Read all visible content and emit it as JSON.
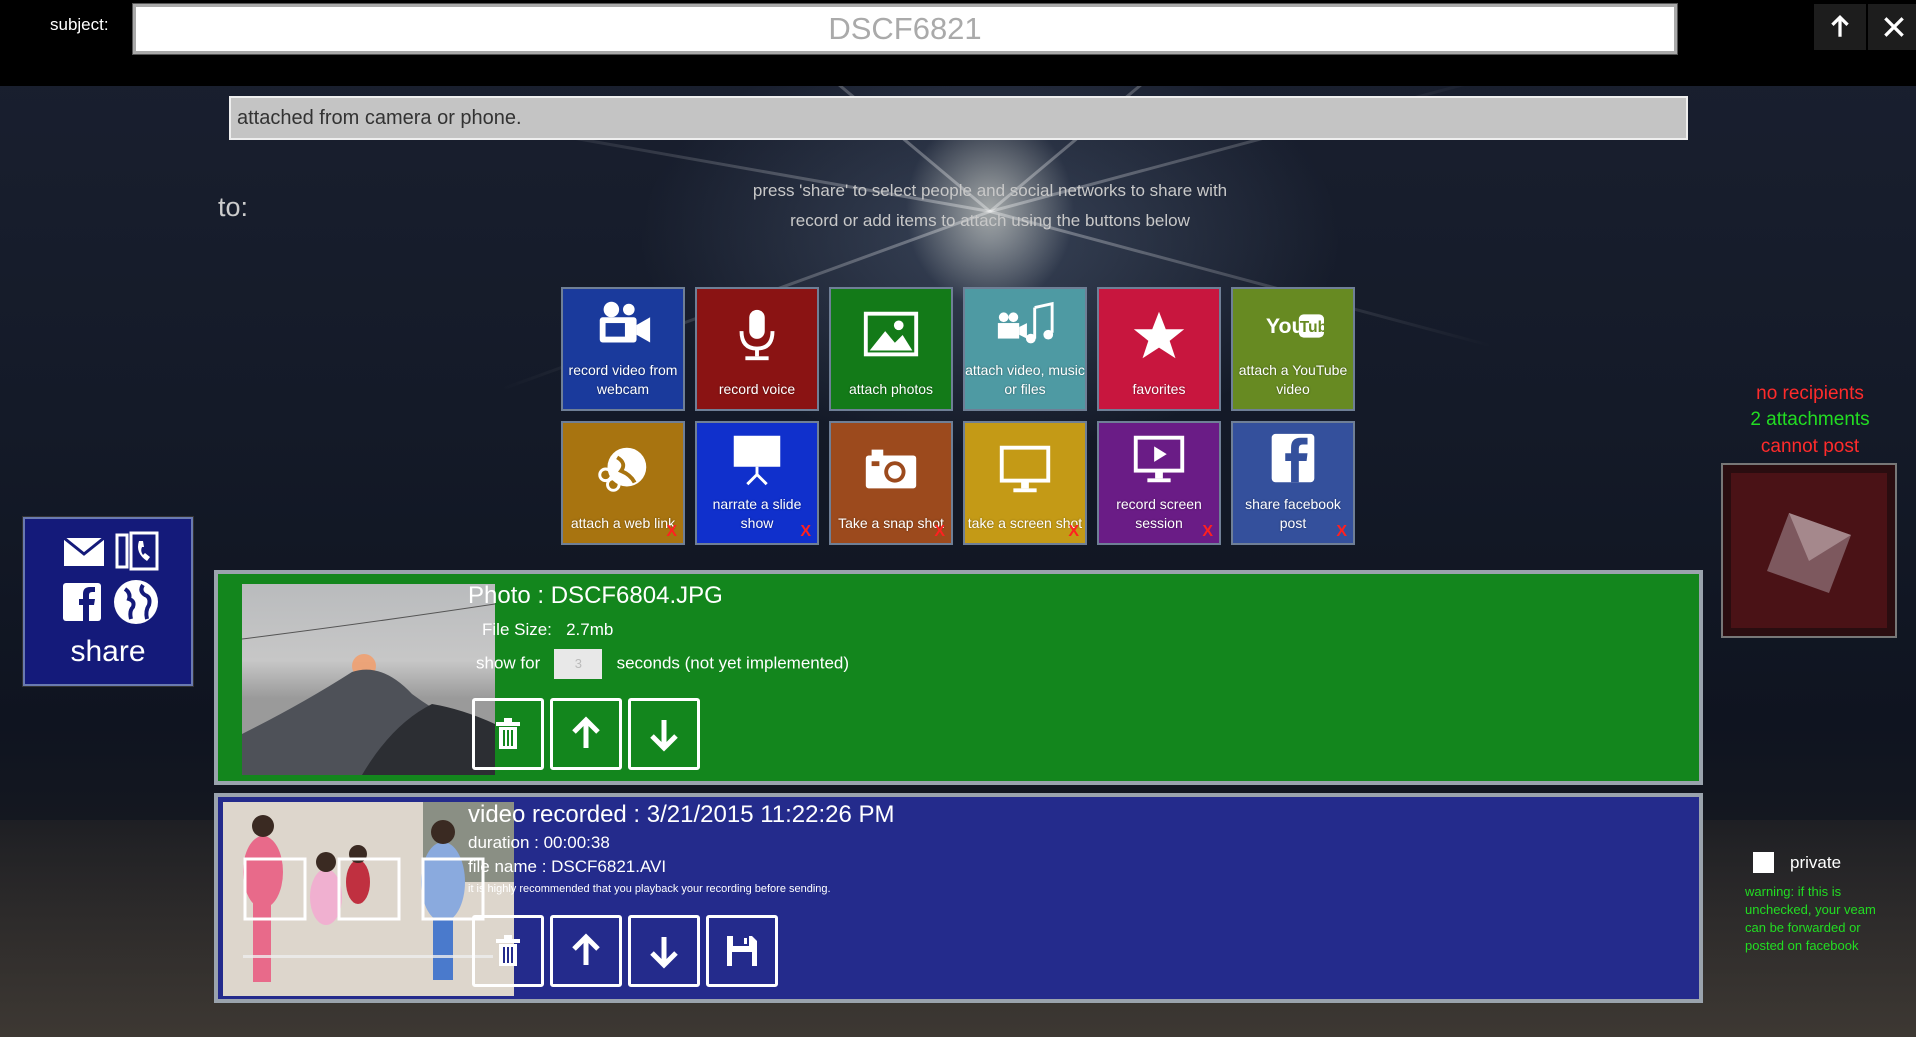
{
  "header": {
    "subject_label": "subject:",
    "subject_value": "DSCF6821",
    "up_icon": "arrow-up-icon",
    "close_icon": "close-icon"
  },
  "message": {
    "value": "attached from camera or phone."
  },
  "to_label": "to:",
  "hints": [
    "press 'share' to select people and social networks to share with",
    "record or add items to attach using the buttons below"
  ],
  "tiles": [
    {
      "label": "record video from webcam",
      "icon": "video-camera-icon",
      "color": "#1a3a9c",
      "disabled": false
    },
    {
      "label": "record voice",
      "icon": "microphone-icon",
      "color": "#8a1313",
      "disabled": false
    },
    {
      "label": "attach photos",
      "icon": "picture-icon",
      "color": "#137a18",
      "disabled": false
    },
    {
      "label": "attach video, music or files",
      "icon": "video-music-icon",
      "color": "#4e9aa3",
      "disabled": false
    },
    {
      "label": "favorites",
      "icon": "star-icon",
      "color": "#c8163e",
      "disabled": false
    },
    {
      "label": "attach a YouTube video",
      "icon": "youtube-icon",
      "color": "#678a22",
      "disabled": false
    },
    {
      "label": "attach a web link",
      "icon": "globe-link-icon",
      "color": "#a87410",
      "disabled": true
    },
    {
      "label": "narrate a slide show",
      "icon": "projector-screen-icon",
      "color": "#1030cc",
      "disabled": true
    },
    {
      "label": "Take a snap shot",
      "icon": "camera-icon",
      "color": "#9c4a1d",
      "disabled": true
    },
    {
      "label": "take a screen shot",
      "icon": "monitor-icon",
      "color": "#c49a16",
      "disabled": true
    },
    {
      "label": "record screen session",
      "icon": "screen-play-icon",
      "color": "#6a1c86",
      "disabled": true
    },
    {
      "label": "share facebook post",
      "icon": "facebook-icon",
      "color": "#34509c",
      "disabled": true
    }
  ],
  "disabled_mark": "X",
  "share": {
    "label": "share",
    "icons": [
      "mail-icon",
      "phone-icon",
      "facebook-icon",
      "globe-icon"
    ]
  },
  "status": {
    "recipients": "no recipients",
    "attachments": "2 attachments",
    "post": "cannot post",
    "colors": {
      "error": "#ff2b2b",
      "ok": "#22dd22"
    }
  },
  "privacy": {
    "label": "private",
    "checked": false,
    "warning": "warning: if this is unchecked, your veam can be forwarded or posted on facebook"
  },
  "attachments": [
    {
      "title": "Photo : DSCF6804.JPG",
      "size_label": "File Size:",
      "size_value": "2.7mb",
      "show_for_label": "show for",
      "seconds_value": "3",
      "seconds_label": "seconds (not yet implemented)",
      "buttons": [
        "trash-icon",
        "arrow-up-icon",
        "arrow-down-icon"
      ]
    },
    {
      "title": "video recorded : 3/21/2015 11:22:26 PM",
      "duration": "duration : 00:00:38",
      "file_name": "file name : DSCF6821.AVI",
      "note": "it is highly recommended that you playback your recording before sending.",
      "buttons": [
        "trash-icon",
        "arrow-up-icon",
        "arrow-down-icon",
        "save-icon"
      ]
    }
  ]
}
